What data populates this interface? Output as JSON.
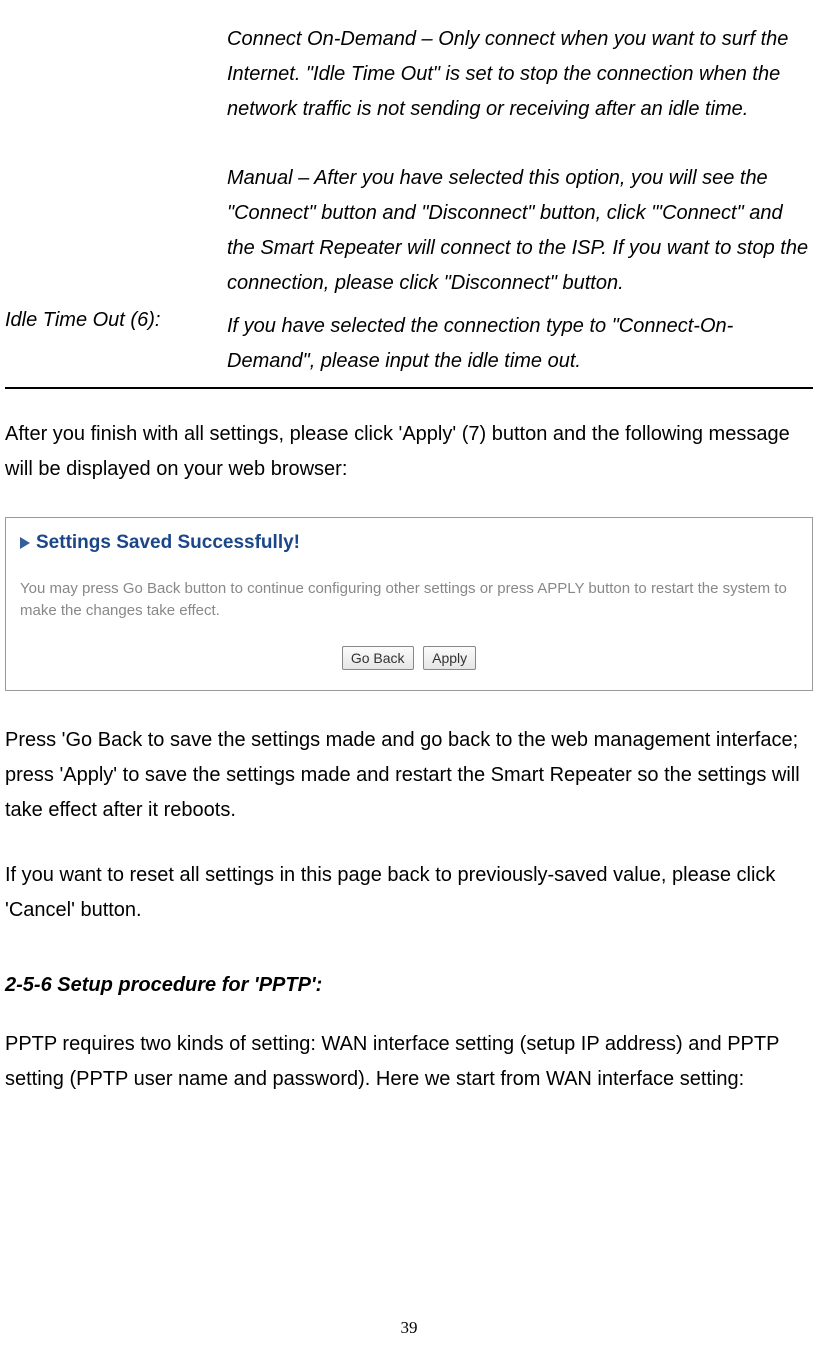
{
  "definitions": {
    "connect_on_demand": "Connect On-Demand – Only connect when you want to surf the Internet. \"Idle Time Out\" is set to stop the connection when the network traffic is not sending or receiving after an idle time.",
    "manual": "Manual – After you have selected this option, you will see the \"Connect\" button and \"Disconnect\" button, click \"'Connect\" and the Smart Repeater will connect to the ISP. If you want to stop the connection, please click \"Disconnect\" button.",
    "idle_label": "Idle Time Out (6):",
    "idle_desc": "If you have selected the connection type to \"Connect-On-Demand\", please input the idle time out."
  },
  "after_settings": "After you finish with all settings, please click 'Apply' (7) button and the following message will be displayed on your web browser:",
  "panel": {
    "title": "Settings Saved Successfully!",
    "desc": "You may press Go Back button to continue configuring other settings or press APPLY button to restart the system to make the changes take effect.",
    "go_back": "Go Back",
    "apply": "Apply"
  },
  "press_goback": "Press 'Go Back to save the settings made and go back to the web management interface; press 'Apply' to save the settings made and restart the Smart Repeater so the settings will take effect after it reboots.",
  "reset_text": "If you want to reset all settings in this page back to previously-saved value, please click 'Cancel' button.",
  "section_heading": "2-5-6 Setup procedure for 'PPTP':",
  "pptp_intro": "PPTP requires two kinds of setting: WAN interface setting (setup IP address) and PPTP setting (PPTP user name and password). Here we start from WAN interface setting:",
  "page_number": "39"
}
